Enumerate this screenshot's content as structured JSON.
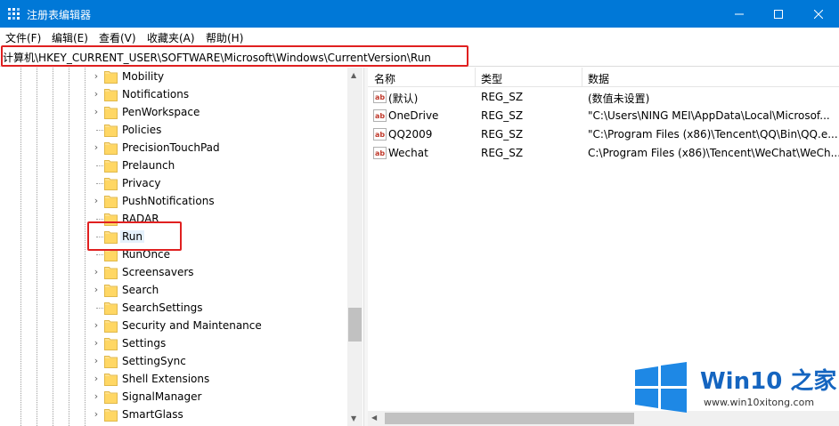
{
  "window": {
    "title": "注册表编辑器",
    "accent": "#0078d7"
  },
  "menu": [
    "文件(F)",
    "编辑(E)",
    "查看(V)",
    "收藏夹(A)",
    "帮助(H)"
  ],
  "address": {
    "path": "计算机\\HKEY_CURRENT_USER\\SOFTWARE\\Microsoft\\Windows\\CurrentVersion\\Run"
  },
  "tree": {
    "items": [
      {
        "label": "Mobility",
        "expandable": true
      },
      {
        "label": "Notifications",
        "expandable": true
      },
      {
        "label": "PenWorkspace",
        "expandable": true
      },
      {
        "label": "Policies",
        "expandable": false
      },
      {
        "label": "PrecisionTouchPad",
        "expandable": true
      },
      {
        "label": "Prelaunch",
        "expandable": false
      },
      {
        "label": "Privacy",
        "expandable": false
      },
      {
        "label": "PushNotifications",
        "expandable": true
      },
      {
        "label": "RADAR",
        "expandable": false
      },
      {
        "label": "Run",
        "expandable": false,
        "selected": true
      },
      {
        "label": "RunOnce",
        "expandable": false
      },
      {
        "label": "Screensavers",
        "expandable": true
      },
      {
        "label": "Search",
        "expandable": true
      },
      {
        "label": "SearchSettings",
        "expandable": false
      },
      {
        "label": "Security and Maintenance",
        "expandable": true
      },
      {
        "label": "Settings",
        "expandable": true
      },
      {
        "label": "SettingSync",
        "expandable": true
      },
      {
        "label": "Shell Extensions",
        "expandable": true
      },
      {
        "label": "SignalManager",
        "expandable": true
      },
      {
        "label": "SmartGlass",
        "expandable": true
      }
    ]
  },
  "list": {
    "headers": {
      "name": "名称",
      "type": "类型",
      "data": "数据"
    },
    "rows": [
      {
        "name": "(默认)",
        "type": "REG_SZ",
        "data": "(数值未设置)"
      },
      {
        "name": "OneDrive",
        "type": "REG_SZ",
        "data": "\"C:\\Users\\NING MEI\\AppData\\Local\\Microsof..."
      },
      {
        "name": "QQ2009",
        "type": "REG_SZ",
        "data": "\"C:\\Program Files (x86)\\Tencent\\QQ\\Bin\\QQ.e..."
      },
      {
        "name": "Wechat",
        "type": "REG_SZ",
        "data": "C:\\Program Files (x86)\\Tencent\\WeChat\\WeCh..."
      }
    ]
  },
  "watermark": {
    "title": "Win10 之家",
    "url": "www.win10xitong.com"
  }
}
